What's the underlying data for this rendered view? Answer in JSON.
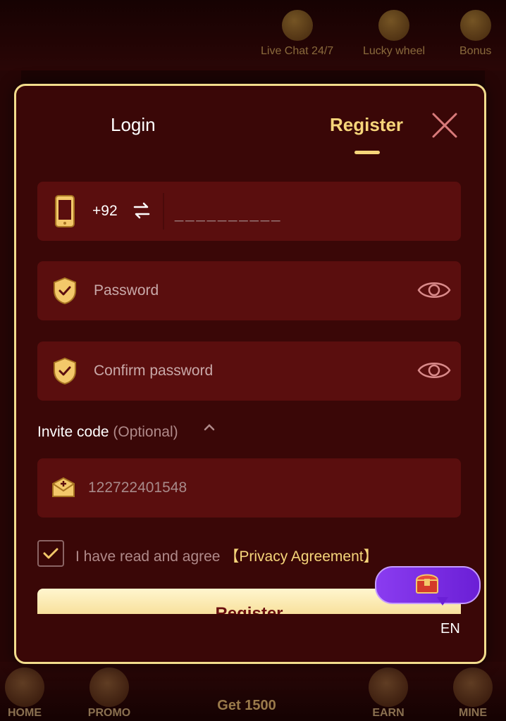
{
  "top_bar": {
    "live_chat": "Live Chat 24/7",
    "lucky_wheel": "Lucky wheel",
    "bonus": "Bonus"
  },
  "bottom_nav": {
    "home": "HOME",
    "promo": "PROMO",
    "center": "Get 1500",
    "earn": "EARN",
    "mine": "MINE"
  },
  "modal": {
    "tabs": {
      "login": "Login",
      "register": "Register",
      "active": "Register"
    },
    "phone": {
      "country_code": "+92",
      "placeholder": "__________"
    },
    "password": {
      "placeholder": "Password"
    },
    "confirm_password": {
      "placeholder": "Confirm password"
    },
    "invite": {
      "label": "Invite code",
      "optional": "(Optional)",
      "value": "122722401548"
    },
    "agreement": {
      "checked": true,
      "text": "I have read and agree",
      "link": "【Privacy Agreement】"
    },
    "register_button": "Register",
    "language": "EN"
  },
  "colors": {
    "accent_gold": "#f6d57a",
    "panel_bg": "#3a0707",
    "field_bg": "#5a0e0e",
    "border_gold": "#f2dc8c",
    "badge_purple": "#7a2ee6"
  },
  "icons": {
    "phone": "phone-icon",
    "swap": "swap-arrows-icon",
    "shield": "shield-check-icon",
    "eye": "eye-icon",
    "invite": "envelope-plus-icon",
    "close": "close-icon",
    "chest": "treasure-chest-icon"
  }
}
